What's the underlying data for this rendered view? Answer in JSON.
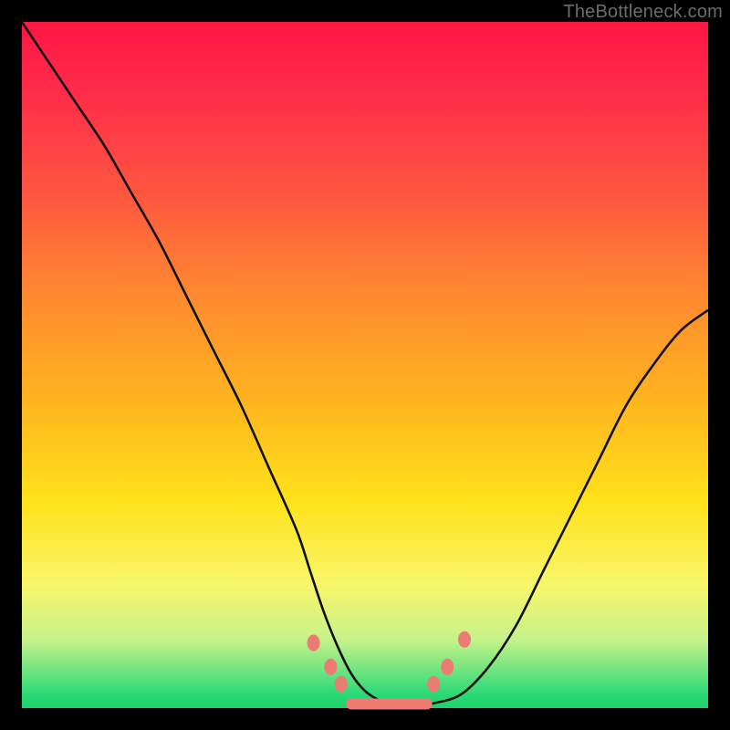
{
  "watermark": {
    "text": "TheBottleneck.com"
  },
  "colors": {
    "gradient_top": "#ff1744",
    "gradient_mid1": "#ff8a2f",
    "gradient_mid2": "#ffe21a",
    "gradient_bottom": "#1ed36b",
    "curve": "#111111",
    "marker": "#ec7b74",
    "frame": "#000000"
  },
  "chart_data": {
    "type": "line",
    "title": "",
    "xlabel": "",
    "ylabel": "",
    "xlim": [
      0,
      100
    ],
    "ylim": [
      0,
      100
    ],
    "grid": false,
    "legend": false,
    "annotations": [],
    "series": [
      {
        "name": "bottleneck-curve",
        "x": [
          0,
          4,
          8,
          12,
          16,
          20,
          24,
          28,
          32,
          36,
          40,
          42,
          44,
          46,
          48,
          50,
          52,
          54,
          56,
          58,
          60,
          64,
          68,
          72,
          76,
          80,
          84,
          88,
          92,
          96,
          100
        ],
        "y": [
          100,
          94,
          88,
          82,
          75,
          68,
          60,
          52,
          44,
          35,
          26,
          20,
          14,
          9,
          5,
          2.5,
          1.2,
          0.6,
          0.5,
          0.5,
          0.7,
          2,
          6,
          12,
          20,
          28,
          36,
          44,
          50,
          55,
          58
        ]
      }
    ],
    "markers": [
      {
        "x": 42.5,
        "y": 9.5
      },
      {
        "x": 45.0,
        "y": 6.0
      },
      {
        "x": 46.5,
        "y": 3.5
      },
      {
        "x": 60.0,
        "y": 3.5
      },
      {
        "x": 62.0,
        "y": 6.0
      },
      {
        "x": 64.5,
        "y": 10.0
      }
    ],
    "floor_segment": {
      "x0": 48,
      "x1": 59,
      "y": 0.6
    }
  }
}
